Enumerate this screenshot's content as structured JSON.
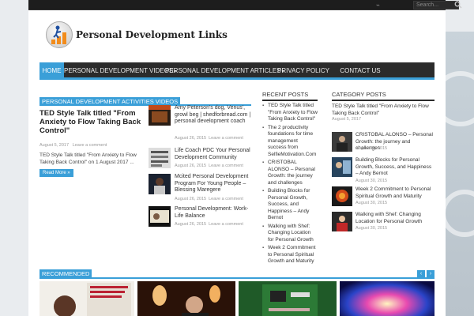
{
  "topbar": {
    "search_placeholder": "Search..."
  },
  "logo": {
    "text": "Personal Development Links"
  },
  "nav": {
    "items": [
      {
        "label": "HOME",
        "active": true
      },
      {
        "label": "PERSONAL DEVELOPMENT VIDEOS",
        "caret": true
      },
      {
        "label": "PERSONAL DEVELOPMENT ARTICLES",
        "caret": true
      },
      {
        "label": "PRIVACY POLICY"
      },
      {
        "label": "CONTACT US"
      }
    ]
  },
  "main": {
    "section_title": "PERSONAL DEVELOPMENT ACTIVITIES VIDEOS",
    "featured": {
      "title": "TED Style Talk titled \"From Anxiety to Flow Taking Back Control\"",
      "date": "August 5, 2017",
      "comments": "Leave a comment",
      "excerpt": "TED Style Talk titled \"From Anxiety to Flow Taking Back Control\" on 1 August 2017 ...",
      "read_more": "Read More »"
    },
    "list": [
      {
        "title": "Amy Peterson's dog, Venus', growl beg | shedforbread.com | personal development coach",
        "date": "August 26, 2015",
        "comments": "Leave a comment"
      },
      {
        "title": "Life Coach PDC Your Personal Development Community",
        "date": "August 26, 2015",
        "comments": "Leave a comment"
      },
      {
        "title": "Mcited Personal Development Program For Young People – Blessing Maregere",
        "date": "August 26, 2015",
        "comments": "Leave a comment"
      },
      {
        "title": "Personal Development: Work-Life Balance",
        "date": "August 26, 2015",
        "comments": "Leave a comment"
      }
    ]
  },
  "recent": {
    "title": "RECENT POSTS",
    "items": [
      "TED Style Talk titled \"From Anxiety to Flow Taking Back Control\"",
      "The 2 productivity foundations for time management success from SelfieMotivation.Com",
      "CRISTOBAL ALONSO – Personal Growth: the journey and challenges",
      "Building Blocks for Personal Growth, Success, and Happiness – Andy Bernot",
      "Walking with Shef: Changing Location for Personal Growth",
      "Week 2 Commitment to Personal Spiritual Growth and Maturity"
    ]
  },
  "category": {
    "title": "CATEGORY POSTS",
    "top_title": "TED Style Talk titled \"From Anxiety to Flow Taking Back Control\"",
    "top_date": "August 5, 2017",
    "items": [
      {
        "title": "CRISTOBAL ALONSO – Personal Growth: the journey and challenges",
        "date": "August 30, 2015"
      },
      {
        "title": "Building Blocks for Personal Growth, Success, and Happiness – Andy Bernot",
        "date": "August 30, 2015"
      },
      {
        "title": "Week 2 Commitment to Personal Spiritual Growth and Maturity",
        "date": "August 30, 2015"
      },
      {
        "title": "Walking with Shef: Changing Location for Personal Growth",
        "date": "August 30, 2015"
      }
    ]
  },
  "recommended": {
    "title": "RECOMMENDED",
    "prev": "‹",
    "next": "›"
  }
}
